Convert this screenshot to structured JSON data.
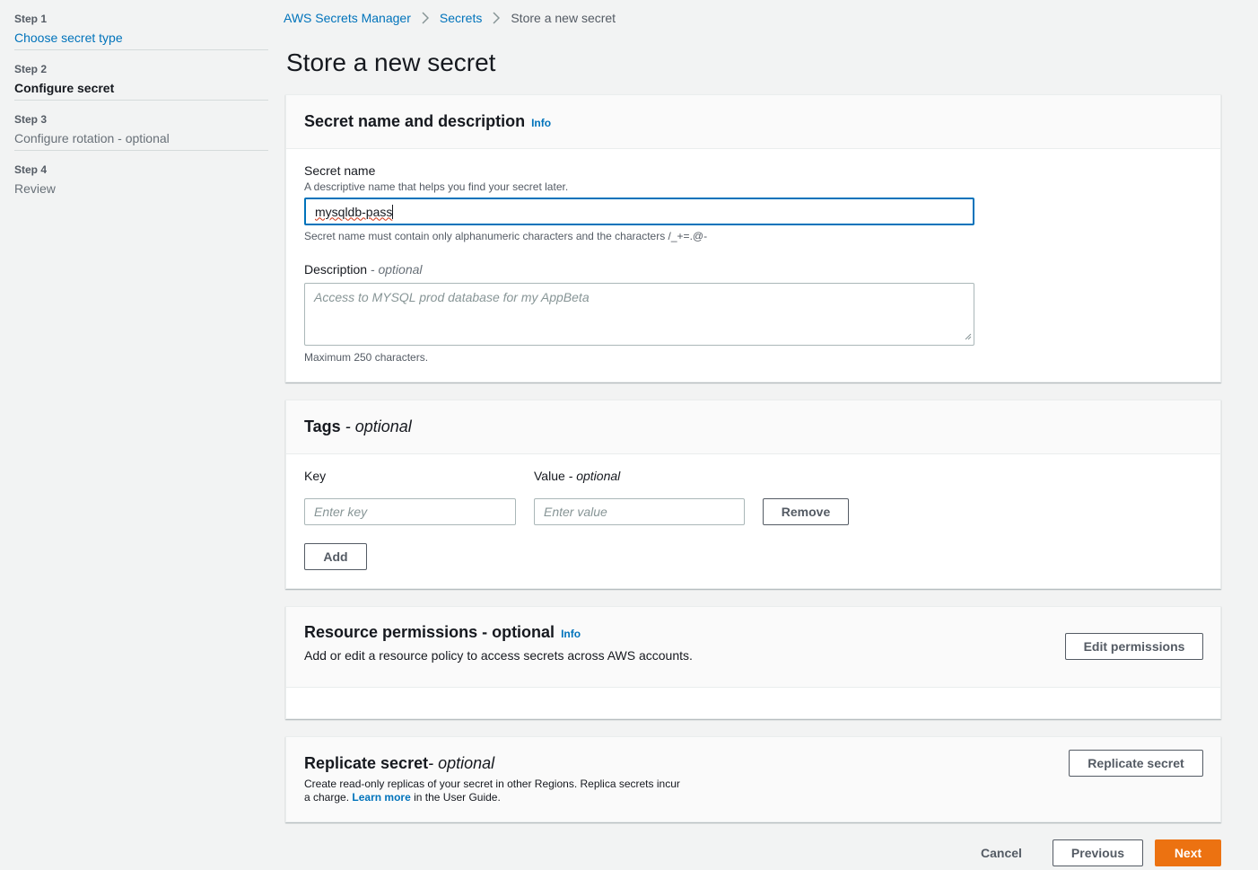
{
  "steps": [
    {
      "num": "Step 1",
      "title": "Choose secret type"
    },
    {
      "num": "Step 2",
      "title": "Configure secret"
    },
    {
      "num": "Step 3",
      "title": "Configure rotation - optional"
    },
    {
      "num": "Step 4",
      "title": "Review"
    }
  ],
  "breadcrumb": [
    "AWS Secrets Manager",
    "Secrets",
    "Store a new secret"
  ],
  "page_title": "Store a new secret",
  "secret_panel": {
    "title": "Secret name and description",
    "info": "Info",
    "name_label": "Secret name",
    "name_desc": "A descriptive name that helps you find your secret later.",
    "name_value": "mysqldb-pass",
    "name_constraint": "Secret name must contain only alphanumeric characters and the characters /_+=.@-",
    "desc_label": "Description",
    "desc_optional": "- optional",
    "desc_placeholder": "Access to MYSQL prod database for my AppBeta",
    "desc_constraint": "Maximum 250 characters."
  },
  "tags_panel": {
    "title": "Tags",
    "optional": "- optional",
    "key_label": "Key",
    "value_label": "Value",
    "value_optional": "- optional",
    "key_placeholder": "Enter key",
    "value_placeholder": "Enter value",
    "remove_label": "Remove",
    "add_label": "Add"
  },
  "permissions_panel": {
    "title": "Resource permissions - optional",
    "info": "Info",
    "desc": "Add or edit a resource policy to access secrets across AWS accounts.",
    "button": "Edit permissions"
  },
  "replicate_panel": {
    "title": "Replicate secret",
    "optional": "- optional",
    "desc_line1": "Create read-only replicas of your secret in other Regions. Replica secrets incur",
    "desc_line2_pre": "a charge.",
    "learn_more": "Learn more",
    "desc_line2_post": "in the User Guide.",
    "button": "Replicate secret"
  },
  "footer": {
    "cancel": "Cancel",
    "previous": "Previous",
    "next": "Next"
  },
  "colors": {
    "link": "#0073bb",
    "primary": "#ec7211",
    "background": "#f2f3f3",
    "focus": "#0073bb"
  }
}
